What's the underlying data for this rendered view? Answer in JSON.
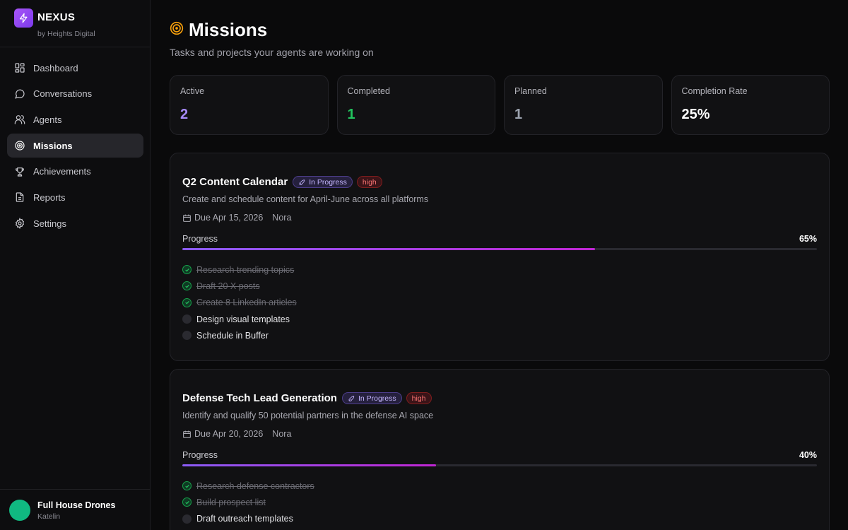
{
  "brand": {
    "name": "NEXUS",
    "subtitle": "by Heights Digital",
    "logo_icon": "lightning-icon",
    "accent": "#a855f7"
  },
  "nav": [
    {
      "label": "Dashboard",
      "icon": "dashboard-icon",
      "active": false
    },
    {
      "label": "Conversations",
      "icon": "chat-bubble-icon",
      "active": false
    },
    {
      "label": "Agents",
      "icon": "users-icon",
      "active": false
    },
    {
      "label": "Missions",
      "icon": "target-icon",
      "active": true
    },
    {
      "label": "Achievements",
      "icon": "trophy-icon",
      "active": false
    },
    {
      "label": "Reports",
      "icon": "document-icon",
      "active": false
    },
    {
      "label": "Settings",
      "icon": "gear-icon",
      "active": false
    }
  ],
  "user": {
    "name": "Full House Drones",
    "subtitle": "Katelin",
    "avatar_color": "#10b981"
  },
  "page": {
    "title": "Missions",
    "subtitle": "Tasks and projects your agents are working on",
    "title_icon": "target-icon"
  },
  "stats": [
    {
      "label": "Active",
      "value": "2",
      "color": "#a78bfa"
    },
    {
      "label": "Completed",
      "value": "1",
      "color": "#22c55e"
    },
    {
      "label": "Planned",
      "value": "1",
      "color": "#9ca3af"
    },
    {
      "label": "Completion Rate",
      "value": "25%",
      "color": "#ffffff"
    }
  ],
  "missions": [
    {
      "title": "Q2 Content Calendar",
      "status": "In Progress",
      "priority": "high",
      "description": "Create and schedule content for April-June across all platforms",
      "due": "Due Apr 15, 2026",
      "owner": "Nora",
      "progress_label": "Progress",
      "progress_text": "65%",
      "progress": 0.65,
      "tasks": [
        {
          "text": "Research trending topics",
          "done": true
        },
        {
          "text": "Draft 20 X posts",
          "done": true
        },
        {
          "text": "Create 8 LinkedIn articles",
          "done": true
        },
        {
          "text": "Design visual templates",
          "done": false
        },
        {
          "text": "Schedule in Buffer",
          "done": false
        }
      ]
    },
    {
      "title": "Defense Tech Lead Generation",
      "status": "In Progress",
      "priority": "high",
      "description": "Identify and qualify 50 potential partners in the defense AI space",
      "due": "Due Apr 20, 2026",
      "owner": "Nora",
      "progress_label": "Progress",
      "progress_text": "40%",
      "progress": 0.4,
      "tasks": [
        {
          "text": "Research defense contractors",
          "done": true
        },
        {
          "text": "Build prospect list",
          "done": true
        },
        {
          "text": "Draft outreach templates",
          "done": false
        }
      ]
    }
  ]
}
